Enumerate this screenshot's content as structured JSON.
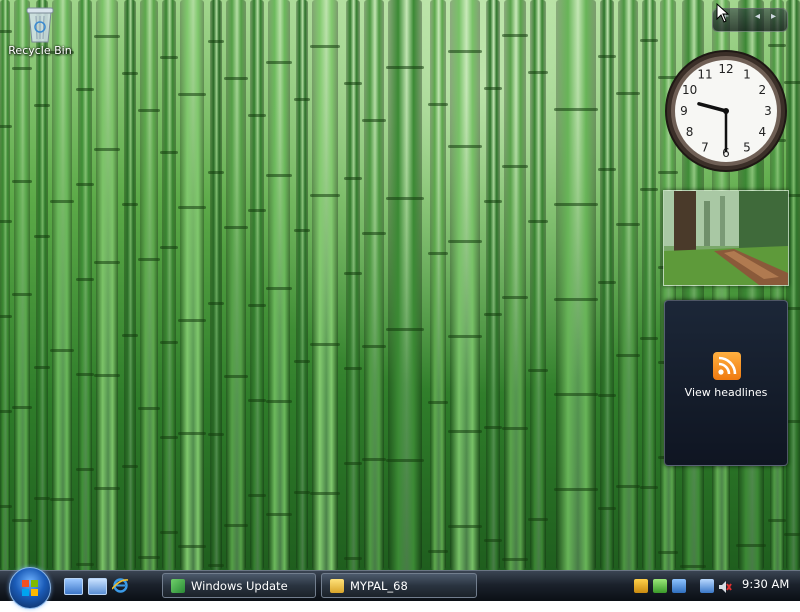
{
  "desktop": {
    "icons": [
      {
        "label": "Recycle Bin",
        "icon": "recycle-bin-icon"
      }
    ]
  },
  "gadgets": {
    "clock": {
      "hour": 9,
      "minute": 30,
      "numerals": [
        "12",
        "1",
        "2",
        "3",
        "4",
        "5",
        "6",
        "7",
        "8",
        "9",
        "10",
        "11"
      ]
    },
    "slideshow": {
      "icon": "slideshow-image"
    },
    "feed": {
      "label": "View headlines",
      "icon": "rss-icon",
      "accent": "#f59a23"
    }
  },
  "taskbar": {
    "start_icon": "windows-start-orb",
    "quick_launch": [
      "show-desktop-icon",
      "switch-windows-icon",
      "internet-explorer-icon"
    ],
    "buttons": [
      {
        "label": "Windows Update",
        "icon": "windows-update-icon"
      },
      {
        "label": "MYPAL_68",
        "icon": "folder-icon"
      }
    ],
    "tray_icons": [
      "security-shield-icon",
      "network-check-icon",
      "network-icon",
      "display-icon",
      "volume-muted-icon"
    ],
    "clock": "9:30 AM"
  },
  "colors": {
    "taskbar": "#1b222c",
    "bamboo": "#3f8f34"
  }
}
